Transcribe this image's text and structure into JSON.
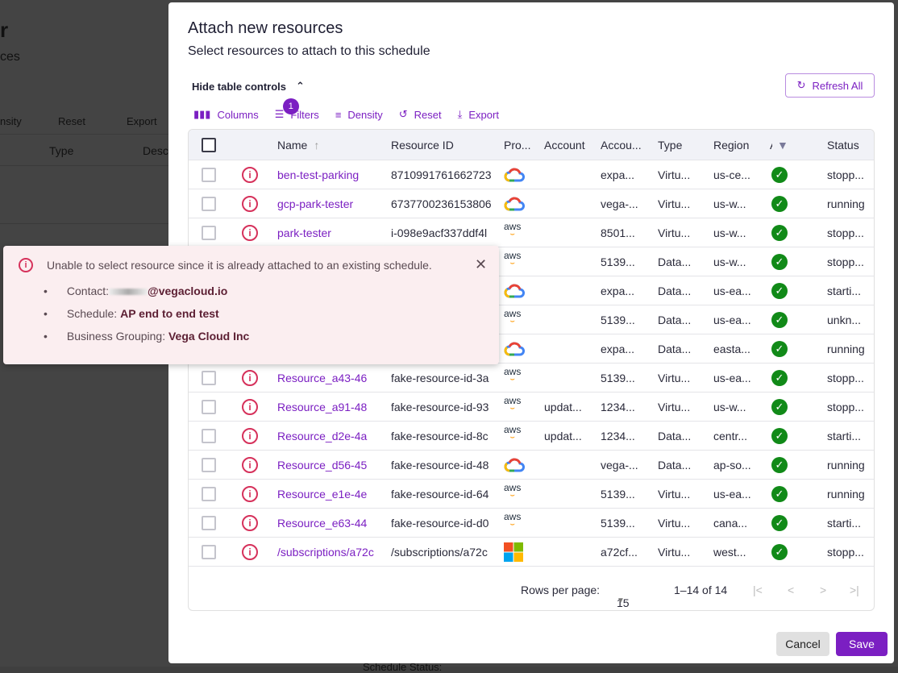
{
  "background": {
    "title_fragment": "r",
    "subtitle_fragment": "ces",
    "toolbar": [
      "nsity",
      "Reset",
      "Export"
    ],
    "columns": [
      "Type",
      "Desc"
    ],
    "footer_fragment": "Schedule Status:"
  },
  "modal": {
    "title": "Attach new resources",
    "subtitle": "Select resources to attach to this schedule",
    "hide_controls": "Hide table controls",
    "refresh_all": "Refresh All",
    "toolbar": {
      "columns": "Columns",
      "filters": "Filters",
      "filter_count": "1",
      "density": "Density",
      "reset": "Reset",
      "export": "Export"
    },
    "columns": [
      "Name",
      "Resource ID",
      "Pro...",
      "Account",
      "Accou...",
      "Type",
      "Region",
      "A",
      "Status"
    ],
    "rows": [
      {
        "name": "ben-test-parking",
        "id": "8710991761662723",
        "provider": "gcp",
        "account": "",
        "account_name": "expa...",
        "type": "Virtu...",
        "region": "us-ce...",
        "status": "stopp..."
      },
      {
        "name": "gcp-park-tester",
        "id": "6737700236153806",
        "provider": "gcp",
        "account": "",
        "account_name": "vega-...",
        "type": "Virtu...",
        "region": "us-w...",
        "status": "running"
      },
      {
        "name": "park-tester",
        "id": "i-098e9acf337ddf4l",
        "provider": "aws",
        "account": "",
        "account_name": "8501...",
        "type": "Virtu...",
        "region": "us-w...",
        "status": "stopp..."
      },
      {
        "name": "",
        "id": "",
        "provider": "aws",
        "account": "",
        "account_name": "5139...",
        "type": "Data...",
        "region": "us-w...",
        "status": "stopp..."
      },
      {
        "name": "",
        "id": "",
        "provider": "gcp",
        "account": "",
        "account_name": "expa...",
        "type": "Data...",
        "region": "us-ea...",
        "status": "starti..."
      },
      {
        "name": "",
        "id": "",
        "provider": "aws",
        "account": "",
        "account_name": "5139...",
        "type": "Data...",
        "region": "us-ea...",
        "status": "unkn..."
      },
      {
        "name": "",
        "id": "",
        "provider": "gcp",
        "account": "",
        "account_name": "expa...",
        "type": "Data...",
        "region": "easta...",
        "status": "running"
      },
      {
        "name": "Resource_a43-46",
        "id": "fake-resource-id-3a",
        "provider": "aws",
        "account": "",
        "account_name": "5139...",
        "type": "Virtu...",
        "region": "us-ea...",
        "status": "stopp..."
      },
      {
        "name": "Resource_a91-48",
        "id": "fake-resource-id-93",
        "provider": "aws",
        "account": "updat...",
        "account_name": "1234...",
        "type": "Virtu...",
        "region": "us-w...",
        "status": "stopp..."
      },
      {
        "name": "Resource_d2e-4a",
        "id": "fake-resource-id-8c",
        "provider": "aws",
        "account": "updat...",
        "account_name": "1234...",
        "type": "Data...",
        "region": "centr...",
        "status": "starti..."
      },
      {
        "name": "Resource_d56-45",
        "id": "fake-resource-id-48",
        "provider": "gcp",
        "account": "",
        "account_name": "vega-...",
        "type": "Data...",
        "region": "ap-so...",
        "status": "running"
      },
      {
        "name": "Resource_e1e-4e",
        "id": "fake-resource-id-64",
        "provider": "aws",
        "account": "",
        "account_name": "5139...",
        "type": "Virtu...",
        "region": "us-ea...",
        "status": "running"
      },
      {
        "name": "Resource_e63-44",
        "id": "fake-resource-id-d0",
        "provider": "aws",
        "account": "",
        "account_name": "5139...",
        "type": "Virtu...",
        "region": "cana...",
        "status": "starti..."
      },
      {
        "name": "/subscriptions/a72c",
        "id": "/subscriptions/a72c",
        "provider": "azure",
        "account": "",
        "account_name": "a72cf...",
        "type": "Virtu...",
        "region": "west...",
        "status": "stopp..."
      }
    ],
    "pagination": {
      "rows_per_page_label": "Rows per page:",
      "rows_per_page": "15",
      "range": "1–14 of 14"
    },
    "cancel": "Cancel",
    "save": "Save"
  },
  "toast": {
    "message": "Unable to select resource since it is already attached to an existing schedule.",
    "contact_label": "Contact:",
    "contact_value": "@vegacloud.io",
    "schedule_label": "Schedule:",
    "schedule_value": "AP end to end test",
    "grouping_label": "Business Grouping:",
    "grouping_value": "Vega Cloud Inc"
  },
  "colors": {
    "accent": "#7b1fc2",
    "error": "#d6315b",
    "success": "#118a18",
    "toast_bg": "#fbeef0"
  }
}
